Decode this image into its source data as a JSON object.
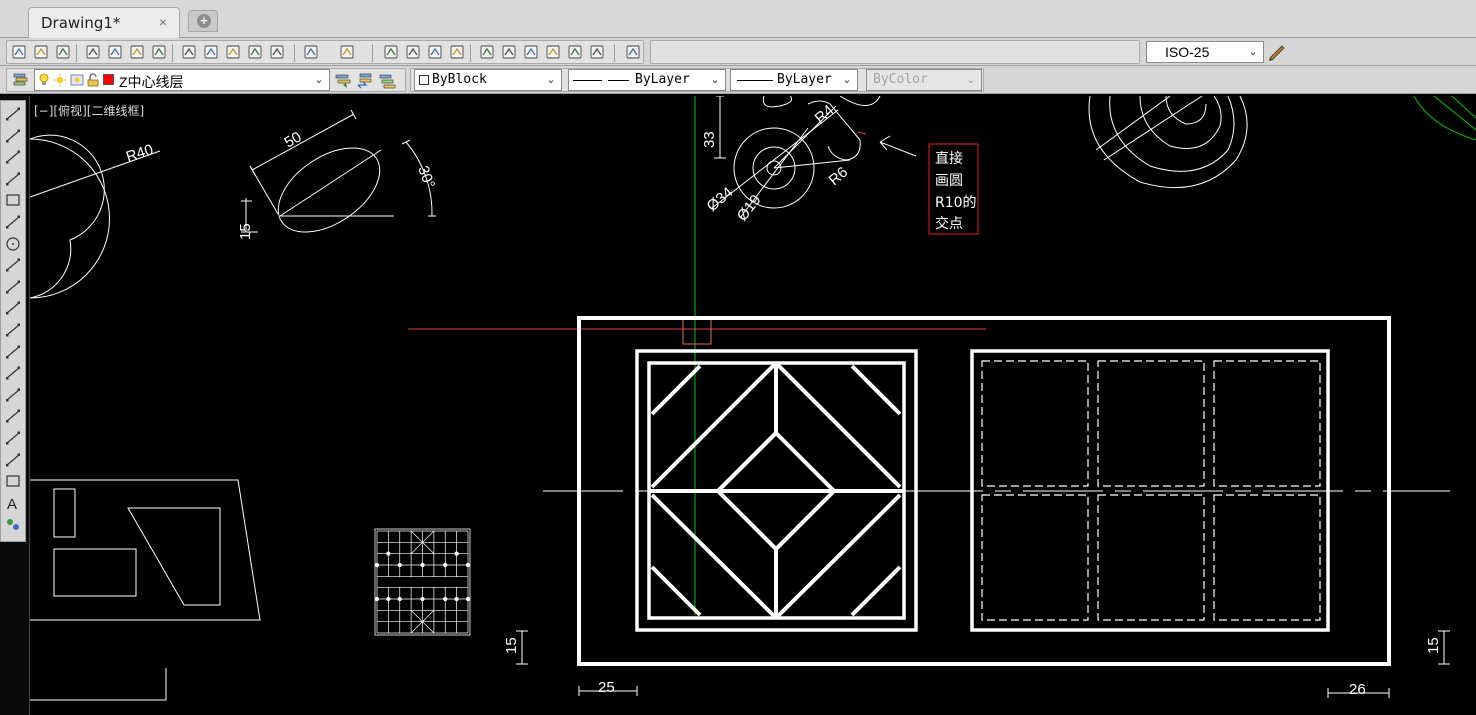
{
  "tabs": {
    "active_title": "Drawing1*",
    "close_glyph": "×",
    "new_glyph": "+"
  },
  "toolbar": {
    "layer_name": "Z中心线层",
    "layer_color": "#ff0000",
    "color_combo": "ByBlock",
    "linetype_combo": "ByLayer",
    "lineweight_combo": "ByLayer",
    "plotstyle_combo": "ByColor",
    "dimstyle_combo": "ISO-25",
    "dropdown_glyph": "⌄"
  },
  "viewport": {
    "label": "[−][俯视][二维线框]"
  },
  "drawing": {
    "dims": {
      "r40": "R40",
      "d50": "50",
      "d15_ellipse": "15",
      "angle30": "30°",
      "d33": "33",
      "r4": "R4",
      "r6": "R6",
      "phi34": "Ø34",
      "phi19": "Ø19",
      "d15_left": "15",
      "d15_right": "15",
      "d25": "25",
      "d26": "26"
    },
    "callout": {
      "line1": "直接",
      "line2": "画圆",
      "line3": "R10的",
      "line4": "交点",
      "border_color": "#e02020"
    },
    "colors": {
      "geometry": "#ffffff",
      "green_axis": "#00c800",
      "red_line": "#e04040",
      "pickbox": "#e0704a"
    }
  }
}
